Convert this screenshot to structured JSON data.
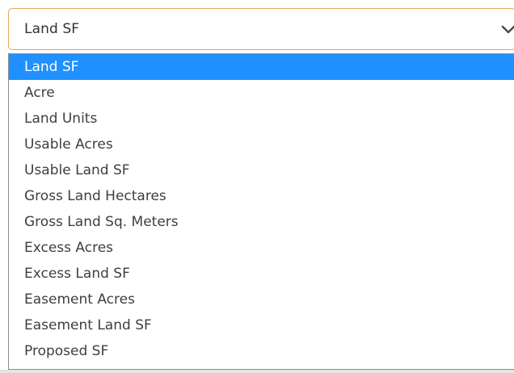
{
  "select": {
    "value": "Land SF",
    "icon": "chevron-down-icon"
  },
  "colors": {
    "select_border": "#e0a55c",
    "highlight": "#1e90ff",
    "text": "#3e3e3e"
  },
  "options": [
    {
      "label": "Land SF",
      "selected": true
    },
    {
      "label": "Acre",
      "selected": false
    },
    {
      "label": "Land Units",
      "selected": false
    },
    {
      "label": "Usable Acres",
      "selected": false
    },
    {
      "label": "Usable Land SF",
      "selected": false
    },
    {
      "label": "Gross Land Hectares",
      "selected": false
    },
    {
      "label": "Gross Land Sq. Meters",
      "selected": false
    },
    {
      "label": "Excess Acres",
      "selected": false
    },
    {
      "label": "Excess Land SF",
      "selected": false
    },
    {
      "label": "Easement Acres",
      "selected": false
    },
    {
      "label": "Easement Land SF",
      "selected": false
    },
    {
      "label": "Proposed SF",
      "selected": false
    }
  ]
}
